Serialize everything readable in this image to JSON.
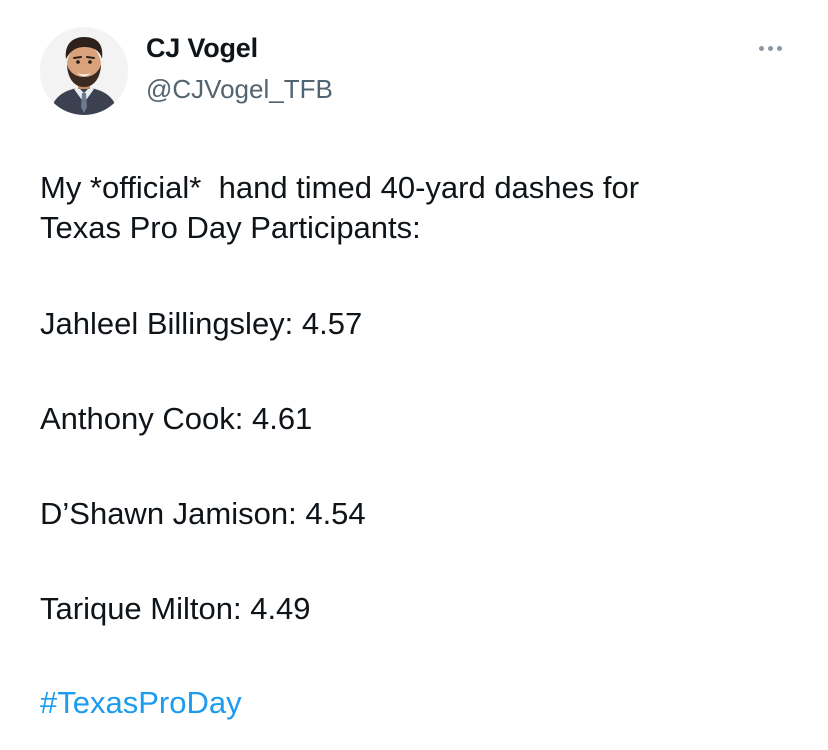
{
  "author": {
    "name": "CJ Vogel",
    "handle": "@CJVogel_TFB"
  },
  "menu": {
    "icon": "more-horizontal-icon"
  },
  "tweet": {
    "intro_line1": "My *official*  hand timed 40-yard dashes for",
    "intro_line2": "Texas Pro Day Participants:",
    "entries": [
      {
        "text": "Jahleel Billingsley: 4.57"
      },
      {
        "text": "Anthony Cook: 4.61"
      },
      {
        "text": "D’Shawn Jamison: 4.54"
      },
      {
        "text": "Tarique Milton: 4.49"
      }
    ],
    "hashtag": "#TexasProDay"
  },
  "colors": {
    "text": "#0f1419",
    "secondary": "#536471",
    "link": "#1d9bf0"
  }
}
